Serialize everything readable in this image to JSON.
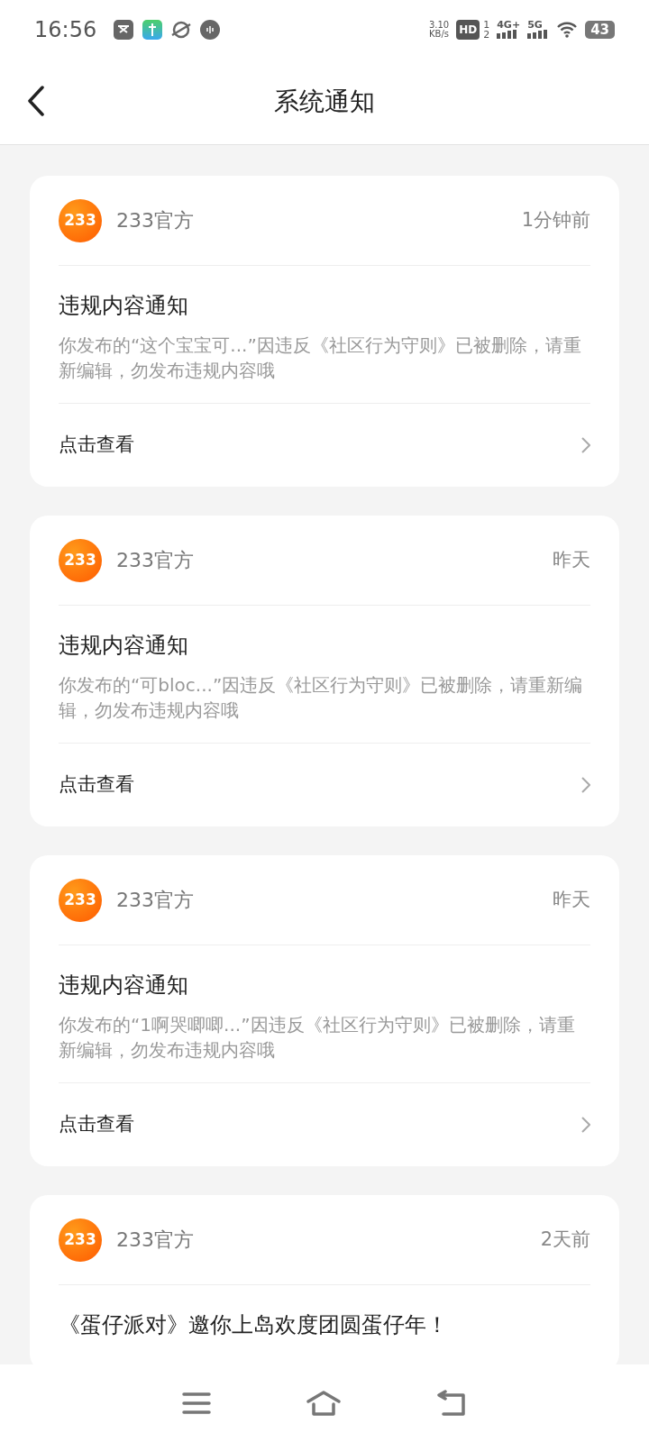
{
  "status_bar": {
    "time": "16:56",
    "speed_value": "3.10",
    "speed_unit": "KB/s",
    "hd_label": "HD",
    "sim_slots": [
      "1",
      "2"
    ],
    "networks": [
      "4G+",
      "5G"
    ],
    "battery": "43"
  },
  "header": {
    "title": "系统通知"
  },
  "notifications": [
    {
      "logo": "233",
      "sender": "233官方",
      "time": "1分钟前",
      "title": "违规内容通知",
      "body": "你发布的“这个宝宝可...”因违反《社区行为守则》已被删除，请重新编辑，勿发布违规内容哦",
      "action": "点击查看"
    },
    {
      "logo": "233",
      "sender": "233官方",
      "time": "昨天",
      "title": "违规内容通知",
      "body": "你发布的“可bloc...”因违反《社区行为守则》已被删除，请重新编辑，勿发布违规内容哦",
      "action": "点击查看"
    },
    {
      "logo": "233",
      "sender": "233官方",
      "time": "昨天",
      "title": "违规内容通知",
      "body": "你发布的“1啊哭唧唧...”因违反《社区行为守则》已被删除，请重新编辑，勿发布违规内容哦",
      "action": "点击查看"
    },
    {
      "logo": "233",
      "sender": "233官方",
      "time": "2天前",
      "title": "《蛋仔派对》邀你上岛欢度团圆蛋仔年！"
    }
  ]
}
